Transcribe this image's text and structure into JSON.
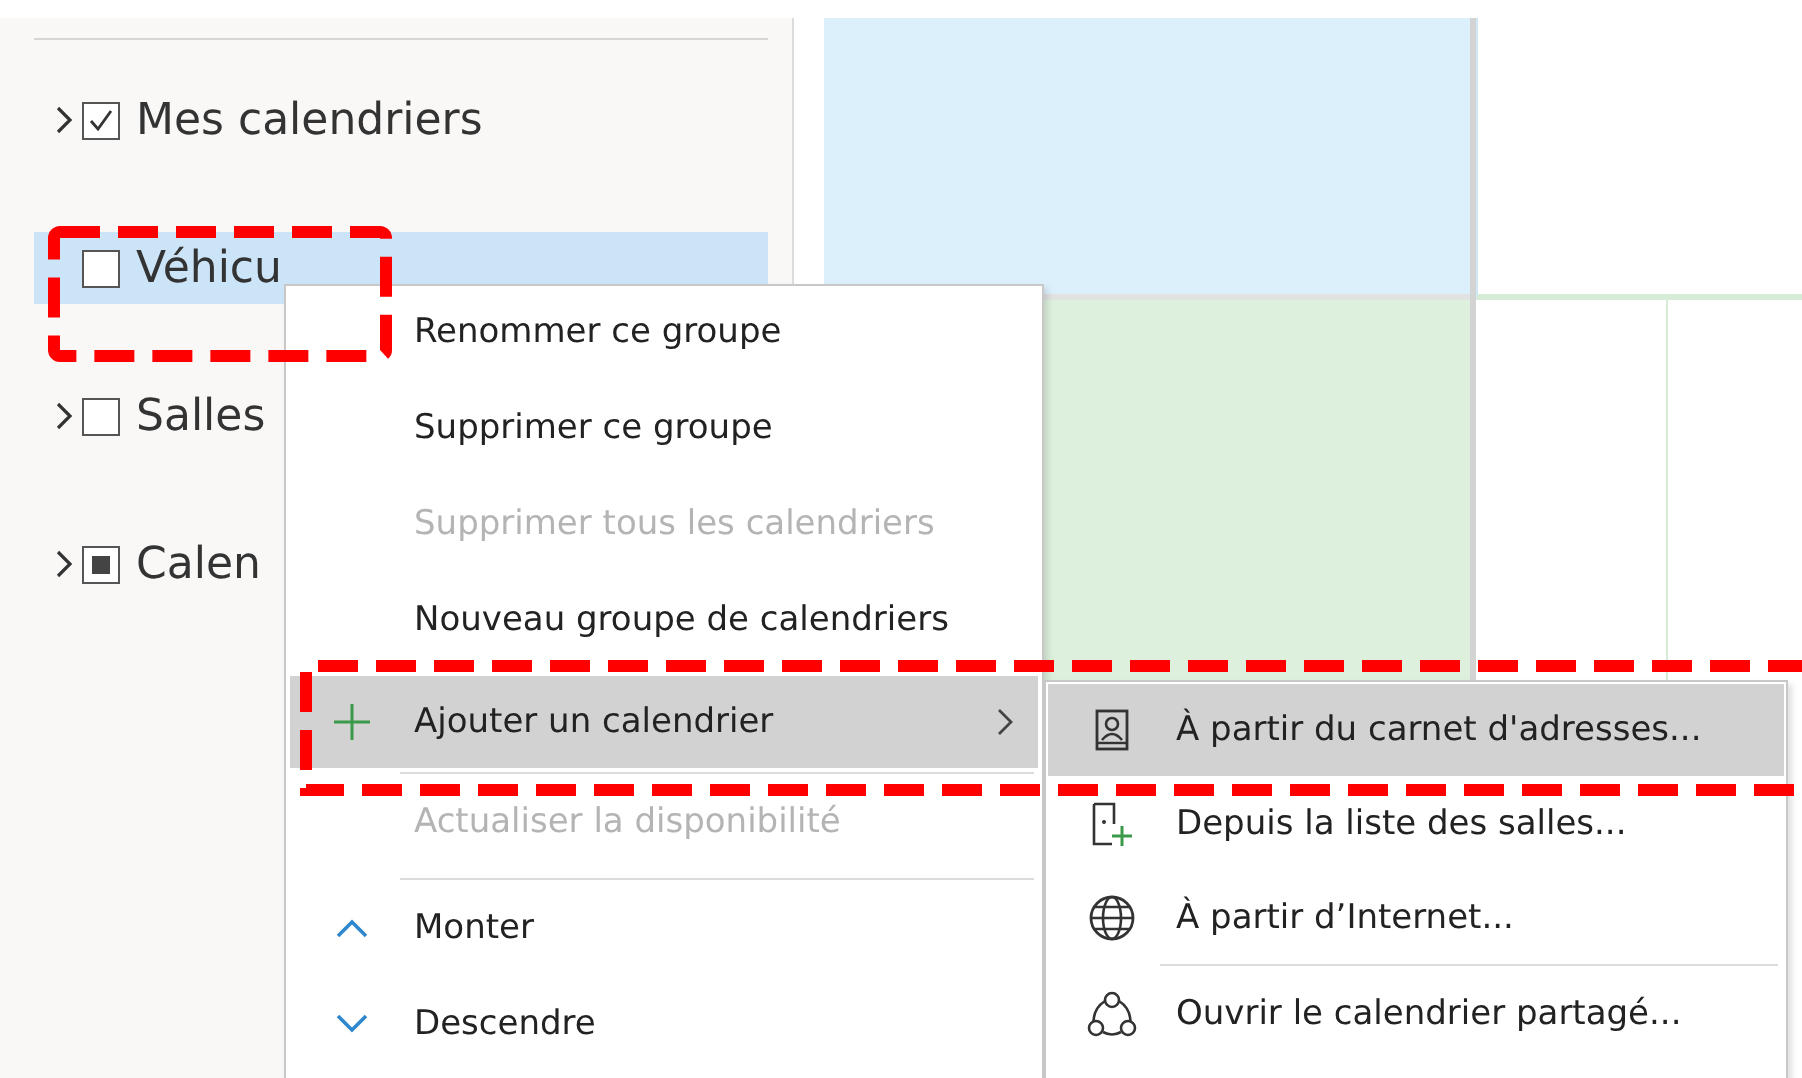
{
  "calendar_groups": [
    {
      "label": "Mes calendriers",
      "expandable": true,
      "checked": true,
      "mixed": false,
      "selected": false
    },
    {
      "label": "Véhicu",
      "expandable": false,
      "checked": false,
      "mixed": false,
      "selected": true
    },
    {
      "label": "Salles",
      "expandable": true,
      "checked": false,
      "mixed": false,
      "selected": false
    },
    {
      "label": "Calen",
      "expandable": true,
      "checked": false,
      "mixed": true,
      "selected": false
    }
  ],
  "context_menu": [
    {
      "kind": "item",
      "label": "Renommer ce groupe",
      "disabled": false,
      "highlighted": false
    },
    {
      "kind": "item",
      "label": "Supprimer ce groupe",
      "disabled": false,
      "highlighted": false
    },
    {
      "kind": "item",
      "label": "Supprimer tous les calendriers",
      "disabled": true,
      "highlighted": false
    },
    {
      "kind": "item",
      "label": "Nouveau groupe de calendriers",
      "disabled": false,
      "highlighted": false
    },
    {
      "kind": "add",
      "label": "Ajouter un calendrier",
      "disabled": false,
      "highlighted": true,
      "submenu": true
    },
    {
      "kind": "separator"
    },
    {
      "kind": "item",
      "label": "Actualiser la disponibilité",
      "disabled": true,
      "highlighted": false
    },
    {
      "kind": "separator"
    },
    {
      "kind": "up",
      "label": "Monter",
      "disabled": false,
      "highlighted": false
    },
    {
      "kind": "down",
      "label": "Descendre",
      "disabled": false,
      "highlighted": false
    }
  ],
  "submenu": [
    {
      "kind": "contact",
      "label": "À partir du carnet d'adresses...",
      "highlighted": true
    },
    {
      "kind": "room",
      "label": "Depuis la liste des salles...",
      "highlighted": false
    },
    {
      "kind": "globe",
      "label": "À partir d’Internet...",
      "highlighted": false
    },
    {
      "kind": "separator"
    },
    {
      "kind": "share",
      "label": "Ouvrir le calendrier partagé...",
      "highlighted": false
    }
  ]
}
